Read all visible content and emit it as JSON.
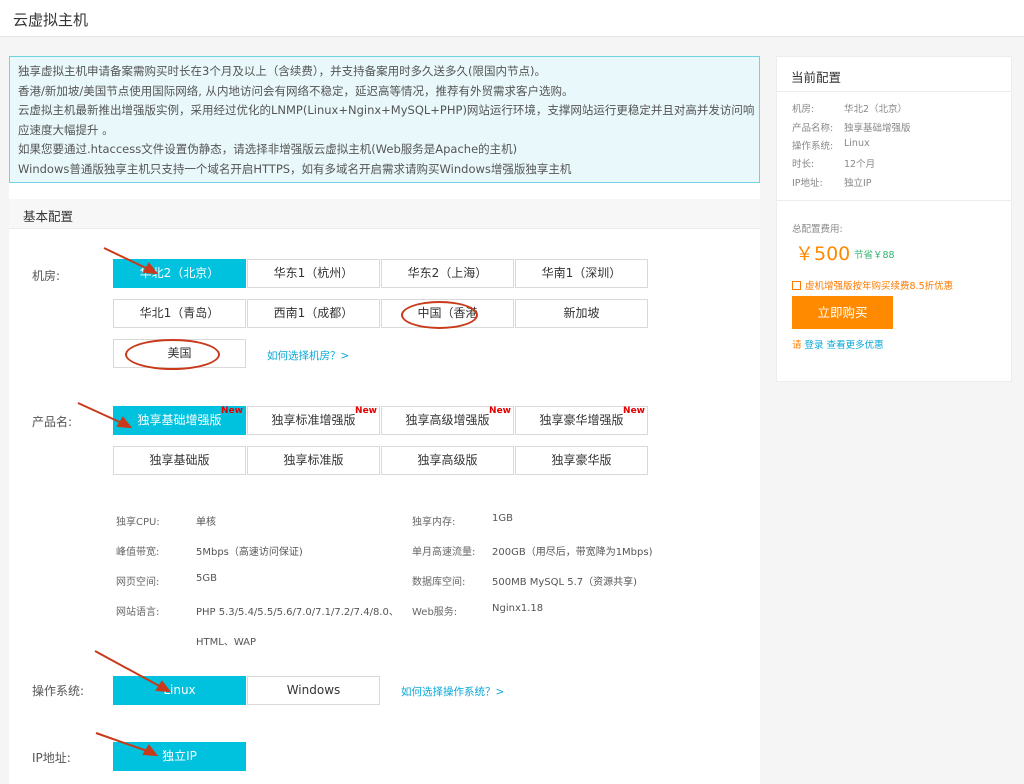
{
  "page": {
    "title": "云虚拟主机"
  },
  "notice": {
    "lines": [
      "独享虚拟主机申请备案需购买时长在3个月及以上（含续费），并支持备案用时多久送多久(限国内节点)。",
      "香港/新加坡/美国节点使用国际网络, 从内地访问会有网络不稳定，延迟高等情况，推荐有外贸需求客户选购。",
      "云虚拟主机最新推出增强版实例，采用经过优化的LNMP(Linux+Nginx+MySQL+PHP)网站运行环境，支撑网站运行更稳定并且对高并发访问响",
      "应速度大幅提升 。",
      "如果您要通过.htaccess文件设置伪静态，请选择非增强版云虚拟主机(Web服务是Apache的主机)",
      "Windows普通版独享主机只支持一个域名开启HTTPS，如有多域名开启需求请购买Windows增强版独享主机"
    ]
  },
  "basic_config": {
    "title": "基本配置",
    "region": {
      "label": "机房:",
      "options": [
        "华北2（北京）",
        "华东1（杭州）",
        "华东2（上海）",
        "华南1（深圳）",
        "华北1（青岛）",
        "西南1（成都）",
        "中国（香港",
        "新加坡",
        "美国"
      ],
      "selected": "华北2（北京）",
      "help_link": "如何选择机房？>"
    },
    "product": {
      "label": "产品名:",
      "options": [
        "独享基础增强版",
        "独享标准增强版",
        "独享高级增强版",
        "独享豪华增强版",
        "独享基础版",
        "独享标准版",
        "独享高级版",
        "独享豪华版"
      ],
      "new_badge": "New",
      "selected": "独享基础增强版"
    },
    "specs": {
      "cpu_label": "独享CPU:",
      "cpu_value": "单核",
      "mem_label": "独享内存:",
      "mem_value": "1GB",
      "bw_label": "峰值带宽:",
      "bw_value": "5Mbps（高速访问保证)",
      "traffic_label": "单月高速流量:",
      "traffic_value": "200GB（用尽后，带宽降为1Mbps)",
      "web_label": "网页空间:",
      "web_value": "5GB",
      "db_label": "数据库空间:",
      "db_value": "500MB MySQL 5.7（资源共享)",
      "lang_label": "网站语言:",
      "lang_value_1": "PHP 5.3/5.4/5.5/5.6/7.0/7.1/7.2/7.4/8.0、",
      "lang_value_2": "HTML、WAP",
      "server_label": "Web服务:",
      "server_value": "Nginx1.18"
    },
    "os": {
      "label": "操作系统:",
      "options": [
        "Linux",
        "Windows"
      ],
      "selected": "Linux",
      "help_link": "如何选择操作系统？>"
    },
    "ip": {
      "label": "IP地址:",
      "options": [
        "独立IP"
      ],
      "selected": "独立IP"
    }
  },
  "current_config": {
    "title": "当前配置",
    "items": [
      {
        "label": "机房:",
        "value": "华北2（北京）"
      },
      {
        "label": "产品名称:",
        "value": "独享基础增强版"
      },
      {
        "label": "操作系统:",
        "value": "Linux"
      },
      {
        "label": "时长:",
        "value": "12个月"
      },
      {
        "label": "IP地址:",
        "value": "独立IP"
      }
    ],
    "total_label": "总配置费用:",
    "price": "￥500",
    "savings": "节省￥88",
    "promo": "虚机增强版按年购买续费8.5折优惠",
    "buy_button": "立即购买",
    "login_prefix": "请 ",
    "login_link": "登录",
    "login_suffix": " 查看更多优惠"
  },
  "colors": {
    "selected": "#00c1de",
    "buy": "#ff8a00",
    "link": "#0aa8d8",
    "annotation": "#c83a1a"
  },
  "icons": [
    "gift-icon"
  ]
}
